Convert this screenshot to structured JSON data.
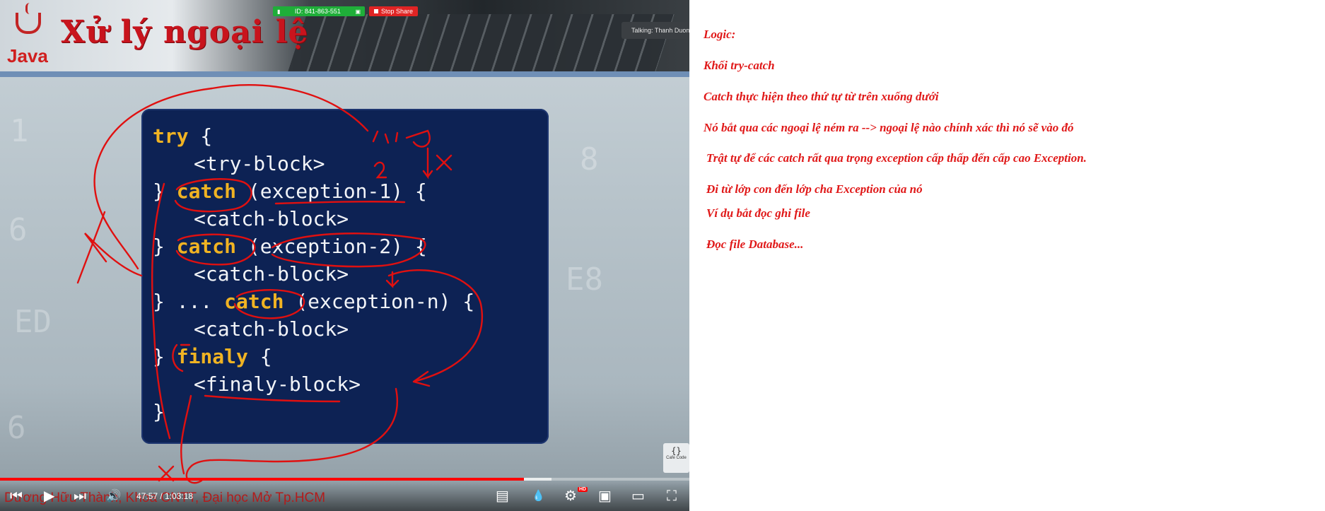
{
  "slide": {
    "title": "Xử lý ngoại lệ",
    "logo_text": "Java",
    "code": {
      "try_kw": "try",
      "open_brace": " {",
      "try_block": "<try-block>",
      "close_brace_prefix": "} ",
      "catch_kw": "catch",
      "exception_1": " (exception-1) {",
      "catch_block": "<catch-block>",
      "exception_2": " (exception-2) {",
      "ellipsis_prefix": "} ... ",
      "exception_n": " (exception-n) {",
      "finaly_kw": "finaly",
      "finaly_block": "<finaly-block>",
      "final_brace": "}"
    },
    "watermark": "Cafe Code",
    "watermark_icon": "{}"
  },
  "zoom": {
    "meeting_id": "ID: 841-863-551",
    "stop_share_label": "Stop Share",
    "talking": "Talking: Thanh Duong"
  },
  "player": {
    "subtitle": "Dương Hữu Thành, Khoa CNTT, Đại học Mở Tp.HCM",
    "time": "47:57 / 1:03:18",
    "progress_fraction": 0.76,
    "hd_label": "HD",
    "icons": {
      "previous": "⏮",
      "play": "▶",
      "next": "⏭",
      "volume": "🔊",
      "subtitles": "▤",
      "droplet": "💧",
      "settings": "⚙",
      "miniplayer": "▣",
      "theater": "▭",
      "fullscreen": "⛶"
    }
  },
  "notes": {
    "lines": [
      "Logic:",
      "Khối try-catch",
      "Catch thực hiện theo thứ tự từ trên xuống dưới",
      "Nó bắt qua các ngoại lệ ném ra --> ngoại lệ nào chính xác thì nó sẽ vào đó",
      "Trật tự để các catch rất qua trọng exception cấp thấp đến cấp cao Exception.",
      "Đi từ lớp con đến lớp cha Exception của nó",
      "Ví dụ bắt đọc ghi file",
      "Đọc file Database..."
    ]
  },
  "colors": {
    "accent_red": "#e01818",
    "code_bg": "#0d2254",
    "keyword": "#f0b323",
    "progress": "#ff0000",
    "zoom_green": "#1fae39"
  }
}
